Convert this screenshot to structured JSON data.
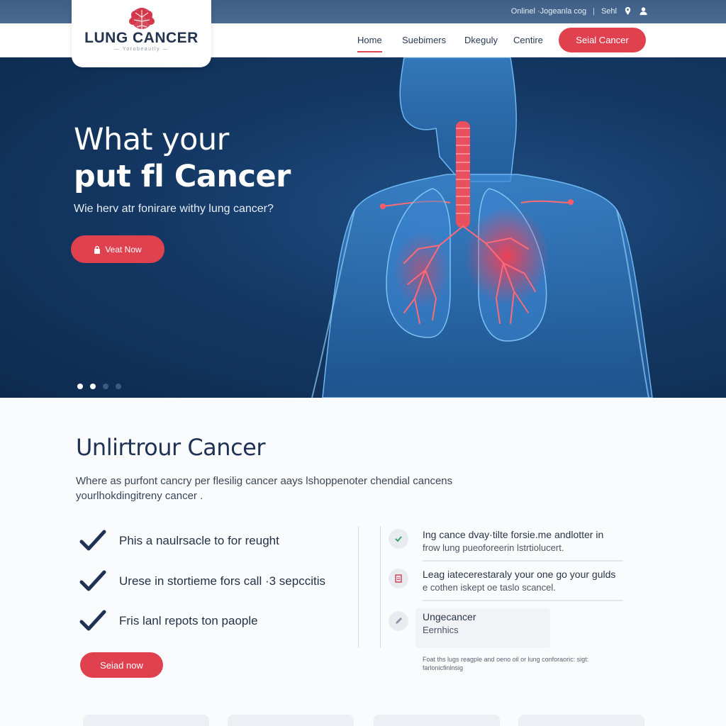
{
  "topbar": {
    "utility_text": "Onlinel ·Jogeanla cog",
    "utility_link": "Sehl"
  },
  "logo": {
    "title": "LUNG CANCER",
    "tagline": "— Yorobeautly —"
  },
  "nav": {
    "items": [
      {
        "label": "Home",
        "active": true
      },
      {
        "label": "Suebimers"
      },
      {
        "label": "Dkeguly"
      },
      {
        "label": "Centire"
      }
    ],
    "cta": "Seial Cancer"
  },
  "hero": {
    "title_line1": "What your",
    "title_line2": "put fl Cancer",
    "subtitle": "Wie herv atr fonirare withy lung cancer?",
    "button": "Veat Now",
    "slides": {
      "total": 4,
      "active": 2
    }
  },
  "section": {
    "title": "Unlirtrour Cancer",
    "description": "Where as purfont cancry per flesilig cancer aays lshoppenoter chendial cancens yourlhokdingitreny cancer ."
  },
  "checklist": [
    "Phis a naulrsacle to for reught",
    "Urese in stortieme fors call ·3 sepccitis",
    "Fris lanl repots ton paople"
  ],
  "secondary_button": "Seiad now",
  "features": [
    {
      "title": "Ing cance dvay·tilte forsie.me andlotter in",
      "subtitle": "frow lung pueoforeerin lstrtiolucert."
    },
    {
      "title": "Leag iatecerestaraly your one go your gulds",
      "subtitle": "e cothen iskept oe taslo scancel."
    },
    {
      "title": "Ungecancer",
      "subtitle": "Eernhics"
    }
  ],
  "fine_print": "Foat ths lugs reagple and oeno oil or lung conforaoric: sigt: farlonicfinlnsig",
  "colors": {
    "accent": "#e0414f",
    "navy": "#1f3256",
    "hero_bg": "#143965",
    "topbar": "#43638b"
  }
}
